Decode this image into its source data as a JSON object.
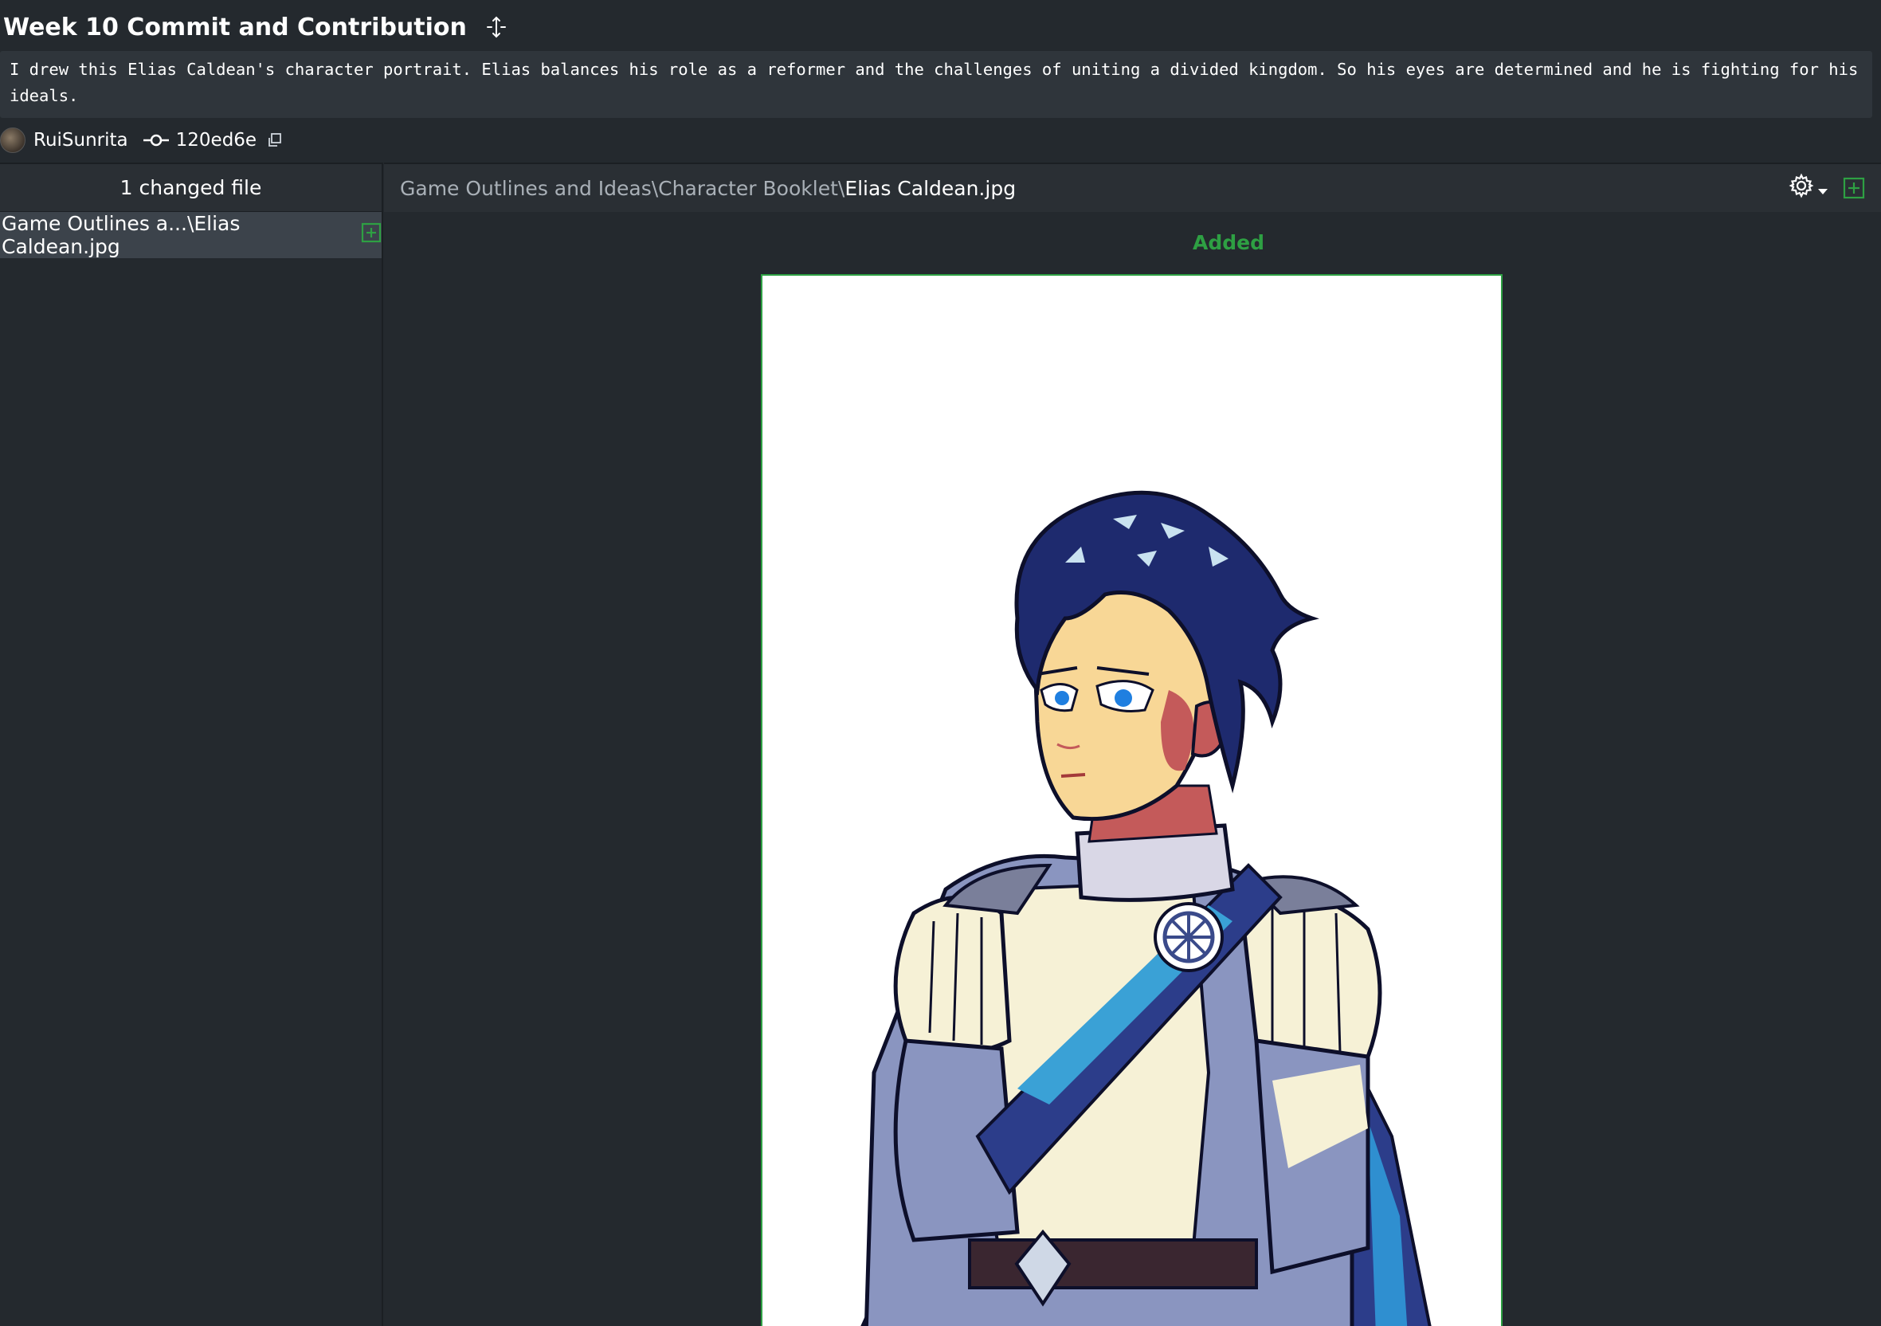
{
  "commit": {
    "title": "Week 10 Commit and Contribution",
    "description": "I drew this Elias Caldean's character portrait. Elias balances his role as a reformer and the challenges of uniting a divided kingdom. So his eyes are determined and he is fighting for his ideals.",
    "author": "RuiSunrita",
    "sha": "120ed6e"
  },
  "files_panel": {
    "header": "1 changed file",
    "items": [
      {
        "label": "Game Outlines a...\\Elias Caldean.jpg",
        "status": "added"
      }
    ]
  },
  "diff": {
    "path_prefix": "Game Outlines and Ideas\\Character Booklet\\",
    "file_name": "Elias Caldean.jpg",
    "status_label": "Added"
  },
  "icons": {
    "move": "move-arrows-icon",
    "commit": "git-commit-icon",
    "copy": "copy-icon",
    "file_added": "plus-square-icon",
    "settings": "gear-icon",
    "dropdown": "caret-down-icon"
  },
  "colors": {
    "background": "#24292e",
    "panel": "#2a2f34",
    "selected_row": "#3c434b",
    "added_green": "#2ea043",
    "muted_text": "#a9b0b7"
  }
}
